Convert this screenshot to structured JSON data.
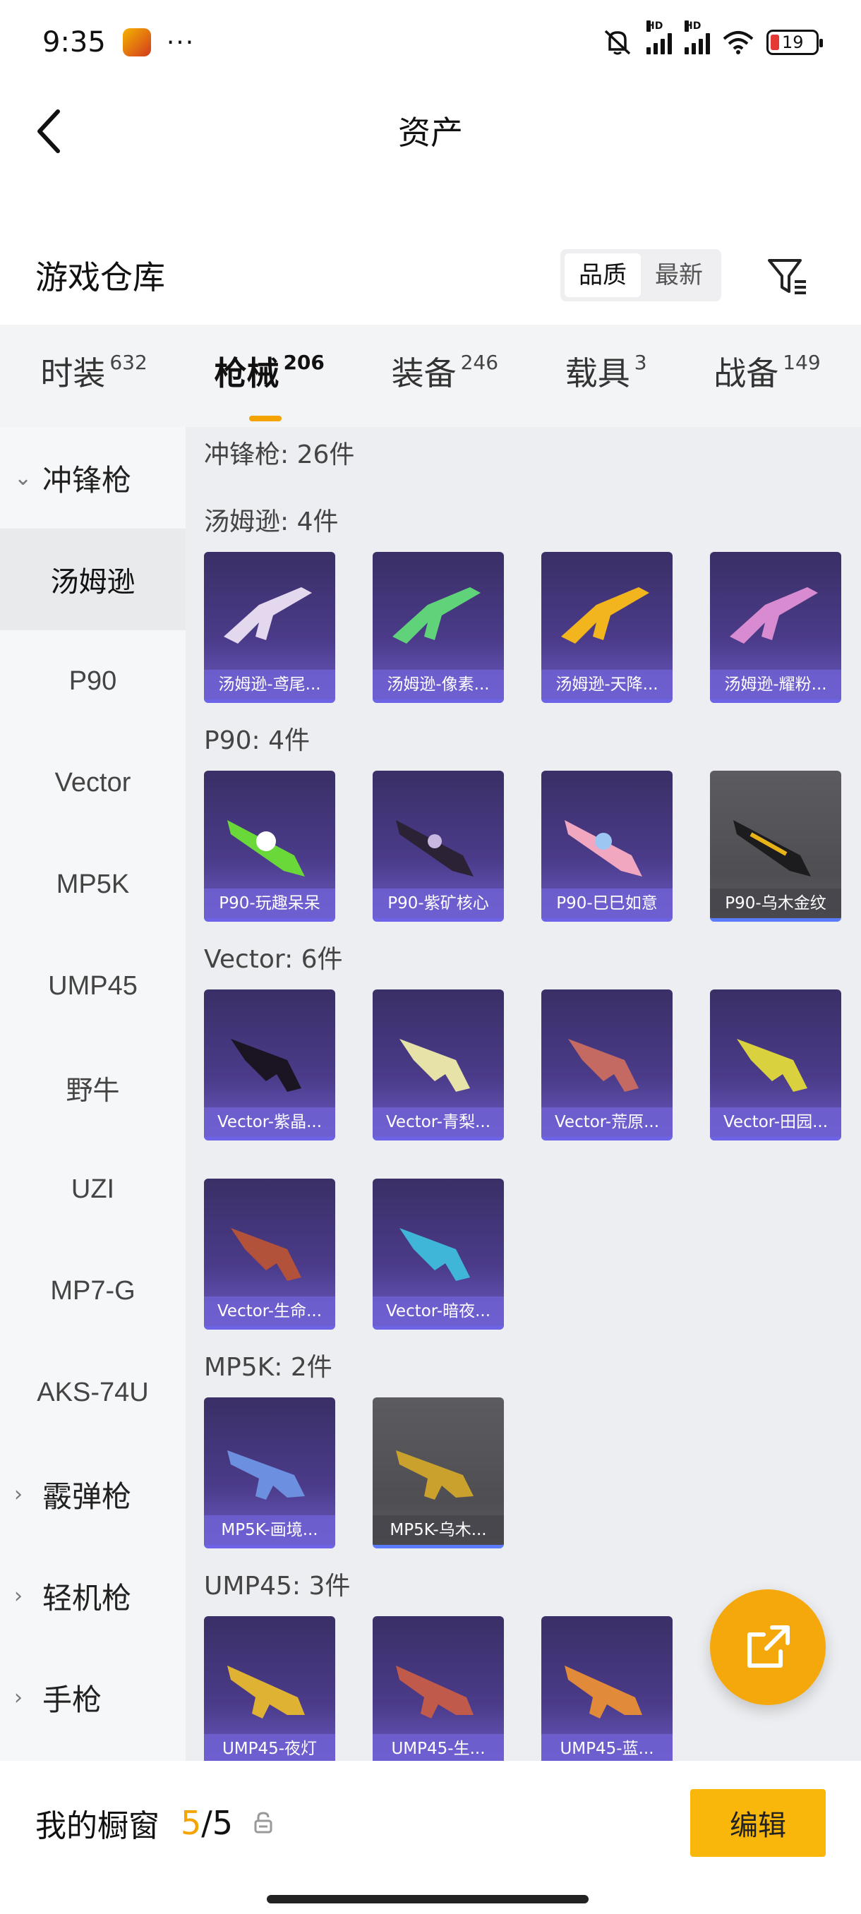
{
  "status_bar": {
    "time": "9:35",
    "dots": "···",
    "battery": "19"
  },
  "header": {
    "title": "资产"
  },
  "warehouse": {
    "title": "游戏仓库",
    "sort_options": [
      "品质",
      "最新"
    ]
  },
  "tabs": [
    {
      "label": "时装",
      "count": "632"
    },
    {
      "label": "枪械",
      "count": "206"
    },
    {
      "label": "装备",
      "count": "246"
    },
    {
      "label": "载具",
      "count": "3"
    },
    {
      "label": "战备",
      "count": "149"
    }
  ],
  "sidebar": {
    "smg": "冲锋枪",
    "items": [
      "汤姆逊",
      "P90",
      "Vector",
      "MP5K",
      "UMP45",
      "野牛",
      "UZI",
      "MP7-G",
      "AKS-74U"
    ],
    "shotgun": "霰弹枪",
    "lmg": "轻机枪",
    "pistol": "手枪"
  },
  "content": {
    "total": "冲锋枪: 26件",
    "sections": {
      "tommy": {
        "header": "汤姆逊: 4件",
        "items": [
          "汤姆逊-鸢尾...",
          "汤姆逊-像素...",
          "汤姆逊-天降...",
          "汤姆逊-耀粉..."
        ]
      },
      "p90": {
        "header": "P90: 4件",
        "items": [
          "P90-玩趣呆呆",
          "P90-紫矿核心",
          "P90-巳巳如意",
          "P90-乌木金纹"
        ]
      },
      "vector": {
        "header": "Vector: 6件",
        "items": [
          "Vector-紫晶...",
          "Vector-青梨...",
          "Vector-荒原...",
          "Vector-田园...",
          "Vector-生命...",
          "Vector-暗夜..."
        ]
      },
      "mp5k": {
        "header": "MP5K: 2件",
        "items": [
          "MP5K-画境...",
          "MP5K-乌木..."
        ]
      },
      "ump45": {
        "header": "UMP45: 3件",
        "items": [
          "UMP45-夜灯",
          "UMP45-生...",
          "UMP45-蓝..."
        ]
      }
    }
  },
  "bottom": {
    "label": "我的橱窗",
    "count_used": "5",
    "count_sep": "/",
    "count_total": "5",
    "edit": "编辑"
  },
  "colors": {
    "accent": "#f5a300",
    "card_purple": "#4b3b8a",
    "card_gray": "#55555a"
  }
}
